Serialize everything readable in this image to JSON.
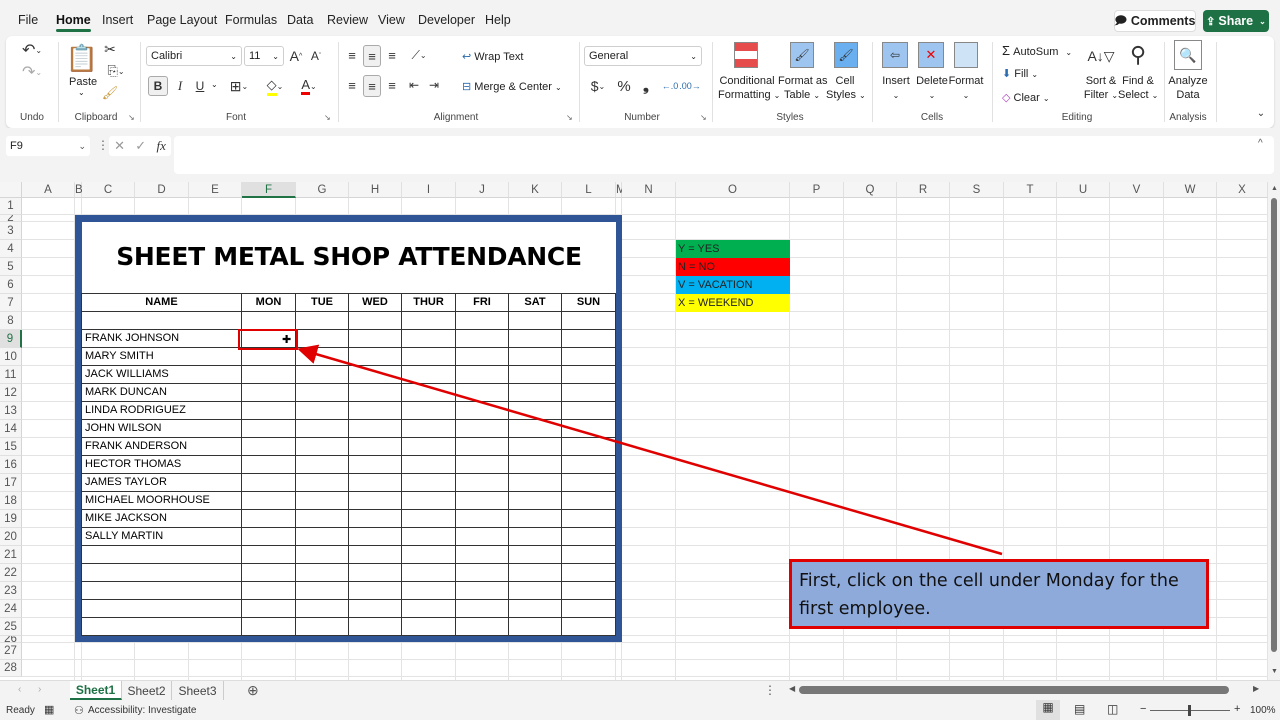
{
  "menu": {
    "tabs": [
      "File",
      "Home",
      "Insert",
      "Page Layout",
      "Formulas",
      "Data",
      "Review",
      "View",
      "Developer",
      "Help"
    ],
    "active": "Home",
    "comments_label": "Comments",
    "share_label": "Share"
  },
  "ribbon": {
    "groups": {
      "undo": "Undo",
      "clipboard": "Clipboard",
      "font": "Font",
      "alignment": "Alignment",
      "number": "Number",
      "styles": "Styles",
      "cells": "Cells",
      "editing": "Editing",
      "analysis": "Analysis"
    },
    "paste_label": "Paste",
    "font_name": "Calibri",
    "font_size": "11",
    "bold": "B",
    "italic": "I",
    "underline": "U",
    "wrap_text": "Wrap Text",
    "merge_center": "Merge & Center",
    "number_format": "General",
    "currency": "$",
    "percent": "%",
    "comma": "❟",
    "conditional_formatting": [
      "Conditional",
      "Formatting"
    ],
    "format_as_table": [
      "Format as",
      "Table"
    ],
    "cell_styles": [
      "Cell",
      "Styles"
    ],
    "insert": "Insert",
    "delete": "Delete",
    "format": "Format",
    "autosum": "AutoSum",
    "fill": "Fill",
    "clear": "Clear",
    "sort_filter": [
      "Sort &",
      "Filter"
    ],
    "find_select": [
      "Find &",
      "Select"
    ],
    "analyze_data": [
      "Analyze",
      "Data"
    ]
  },
  "formula_bar": {
    "name_box": "F9",
    "fx": "fx",
    "value": ""
  },
  "columns": [
    "A",
    "B",
    "C",
    "D",
    "E",
    "F",
    "G",
    "H",
    "I",
    "J",
    "K",
    "L",
    "M",
    "N",
    "O",
    "P",
    "Q",
    "R",
    "S",
    "T",
    "U",
    "V",
    "W",
    "X"
  ],
  "rows": [
    "1",
    "2",
    "3",
    "4",
    "5",
    "6",
    "7",
    "8",
    "9",
    "10",
    "11",
    "12",
    "13",
    "14",
    "15",
    "16",
    "17",
    "18",
    "19",
    "20",
    "21",
    "22",
    "23",
    "24",
    "25",
    "26",
    "27",
    "28"
  ],
  "selected_cell": "F9",
  "attendance": {
    "title": "SHEET METAL SHOP ATTENDANCE",
    "headers": [
      "NAME",
      "MON",
      "TUE",
      "WED",
      "THUR",
      "FRI",
      "SAT",
      "SUN"
    ],
    "employees": [
      "FRANK JOHNSON",
      "MARY SMITH",
      "JACK WILLIAMS",
      "MARK DUNCAN",
      "LINDA RODRIGUEZ",
      "JOHN WILSON",
      "FRANK ANDERSON",
      "HECTOR THOMAS",
      "JAMES TAYLOR",
      "MICHAEL MOORHOUSE",
      "MIKE JACKSON",
      "SALLY MARTIN",
      "",
      "",
      "",
      "",
      ""
    ]
  },
  "legend": [
    {
      "label": "Y = YES",
      "color": "#00b050"
    },
    {
      "label": "N = NO",
      "color": "#ff0000"
    },
    {
      "label": "V = VACATION",
      "color": "#00b0f0"
    },
    {
      "label": "X = WEEKEND",
      "color": "#ffff00"
    }
  ],
  "callout": {
    "text": "First, click on the cell under Monday for the first employee.",
    "border_color": "#e00000",
    "fill_color": "#8eaadb"
  },
  "sheets": [
    "Sheet1",
    "Sheet2",
    "Sheet3"
  ],
  "active_sheet": "Sheet1",
  "status": {
    "ready": "Ready",
    "accessibility": "Accessibility: Investigate",
    "zoom": "100%"
  }
}
